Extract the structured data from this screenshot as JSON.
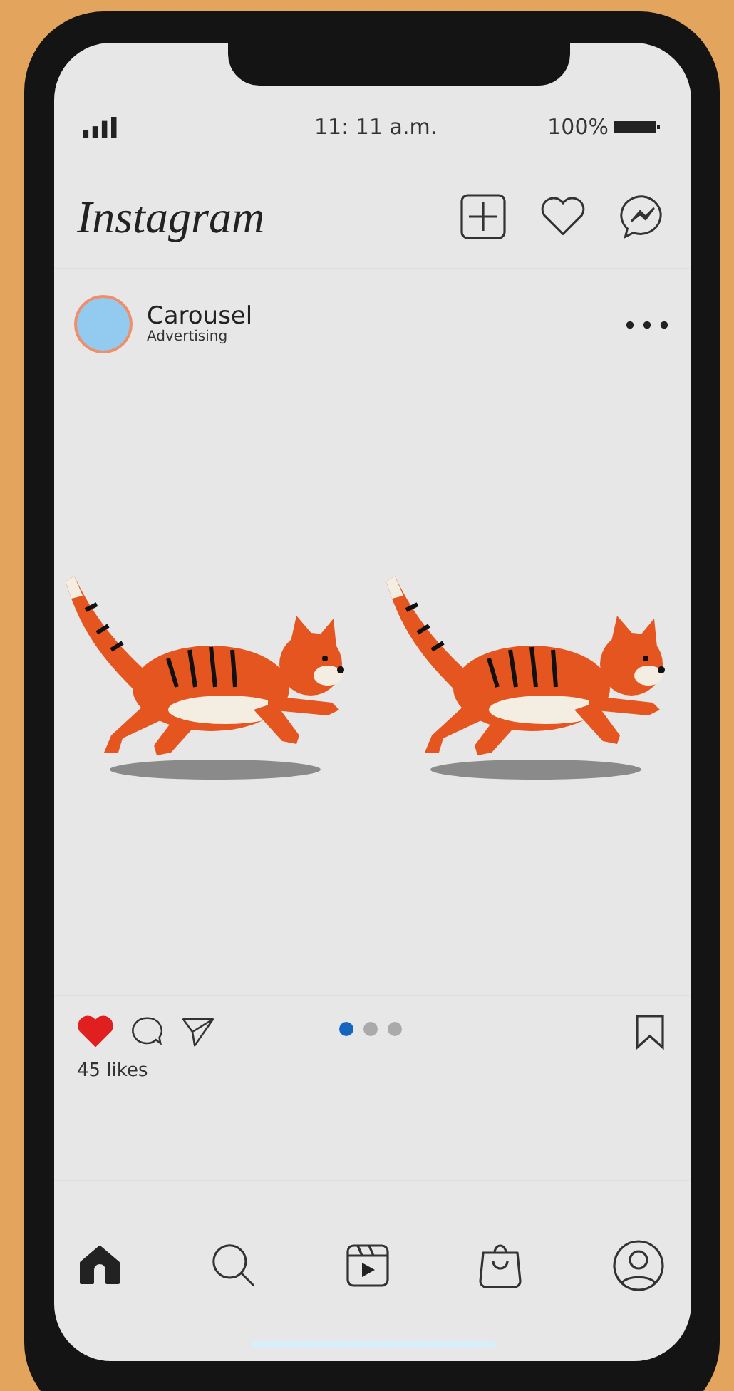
{
  "status_bar": {
    "time": "11: 11 a.m.",
    "battery": "100%"
  },
  "header": {
    "logo": "Instagram"
  },
  "post": {
    "username": "Carousel",
    "subtitle": "Advertising",
    "liked": true,
    "likes": "45 likes",
    "dots": [
      {
        "selected": true
      },
      {
        "selected": false
      },
      {
        "selected": false
      }
    ]
  },
  "bottom_nav": [
    {
      "kind": "home",
      "selected": true
    },
    {
      "kind": "search",
      "selected": false
    },
    {
      "kind": "reels",
      "selected": false
    },
    {
      "kind": "shop",
      "selected": false
    },
    {
      "kind": "profile",
      "selected": false
    }
  ]
}
